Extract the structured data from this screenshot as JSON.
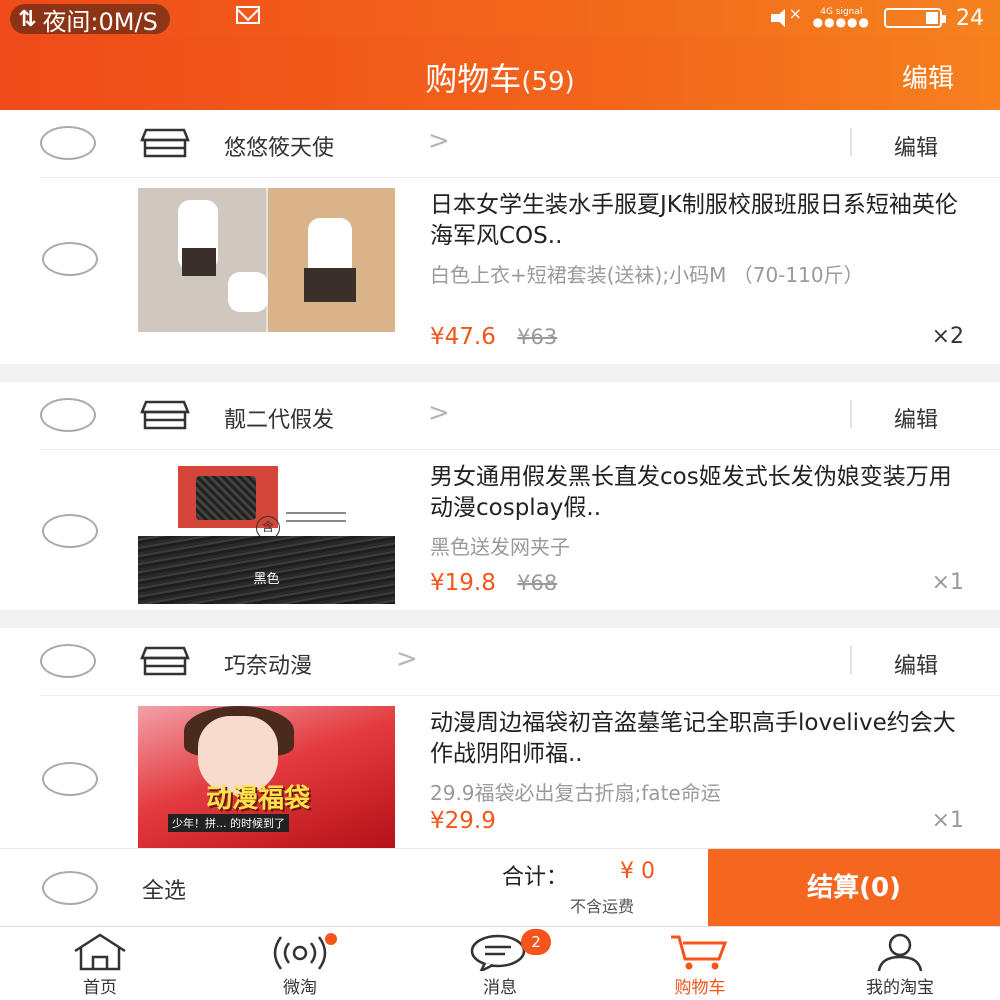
{
  "status_bar": {
    "speed_text": "夜间:0M/S",
    "sync_icon": "sync-icon",
    "mail_icon": "mail-icon",
    "network": "4G signal",
    "battery": "24"
  },
  "header": {
    "title": "购物车",
    "count": "(59)",
    "edit_label": "编辑"
  },
  "shops": [
    {
      "name": "悠悠筱天使",
      "edit_label": "编辑",
      "item": {
        "title": "日本女学生装水手服夏JK制服校服班服日系短袖英伦海军风COS..",
        "spec": "白色上衣+短裙套装(送袜);小码M （70-110斤）",
        "price": "¥47.6",
        "old_price": "¥63",
        "qty": "×2"
      }
    },
    {
      "name": "靓二代假发",
      "edit_label": "编辑",
      "item": {
        "title": "男女通用假发黑长直发cos姬发式长发伪娘变装万用动漫cosplay假..",
        "spec": "黑色送发网夹子",
        "price": "¥19.8",
        "old_price": "¥68",
        "qty": "×1",
        "image_text_1": "含",
        "image_text_2": "黑色"
      }
    },
    {
      "name": "巧奈动漫",
      "edit_label": "编辑",
      "item": {
        "title": "动漫周边福袋初音盗墓笔记全职高手lovelive约会大作战阴阳师福..",
        "spec": "29.9福袋必出复古折扇;fate命运",
        "price": "¥29.9",
        "old_price": "",
        "qty": "×1",
        "image_text_1": "动漫福袋",
        "image_text_2": "少年！拼... 的时候到了"
      }
    }
  ],
  "summary": {
    "select_all": "全选",
    "total_label": "合计：",
    "total_value": "¥ 0",
    "shipping_note": "不含运费",
    "checkout_label": "结算(0)"
  },
  "tabs": [
    {
      "label": "首页",
      "icon": "home-icon"
    },
    {
      "label": "微淘",
      "icon": "broadcast-icon"
    },
    {
      "label": "消息",
      "icon": "message-icon",
      "badge": "2"
    },
    {
      "label": "购物车",
      "icon": "cart-icon"
    },
    {
      "label": "我的淘宝",
      "icon": "user-icon"
    }
  ],
  "colors": {
    "brand_orange": "#f5661f",
    "price": "#f5551a"
  }
}
